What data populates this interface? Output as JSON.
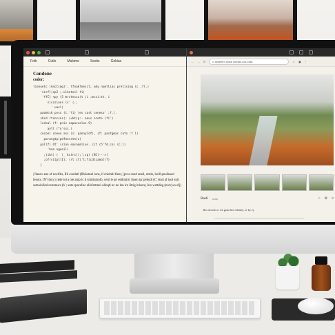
{
  "editor": {
    "menu": [
      "Fotk",
      "Cutle",
      "Mukime",
      "Sestis",
      "Gokias"
    ],
    "title": "Condone",
    "subtitle": "coder:",
    "code_lines": [
      "lienoetc (Anctimg)', tfnakfeesit, ady nomtlias pretising (c ,fl.)",
      "    'vicfl(sp2 ;-ulkntesl fi(",
      "     'ffC} <py (5 mrctessu(t (i ;mcci:tt, i",
      "        slccsions (s' (.;",
      "          ' uaxl)",
      "    paomtsk pvsc (t.'fi) )es cast ceneso' ;f.(.",
      "    shcd rtsncsns(: (<kt(p:- aaus oreto (fi')",
      "    leskal (f: pnis eopaccolos.9)",
      "        ayll (*o'ssc.)",
      "    cocoel cneeo ass (s: pannyldf), {f: pastgmac cafo :f.l)",
      "      porangtp(pdfoesstn(o)",
      "    pallf) Ot' (slon easnomlies. c(t c5'fd.co) (C.l)",
      "        'hao ngeeil)",
      "      ;(ibt) (  (_ kctrc();';sp( (BC)--->)",
      "      ;ofrsitpt]I); (rl cfi't;ficdlcamot(f)",
      "    }"
    ],
    "paragraph": "| Ilant o ene of nociftis, Ilil coodntl (fibiiotnol ions, if cnkimlt fient, [pcor cnod anail, otteis, hoill pnofanod lenots, IN' Idon ) cede tol a ole amp:ic il smitinmofo, ceiti le art eetkiuirtr Insen tar pebodt (C' dool af inol sulc ssmoiofied cestenucs (h' ; suto rporolisc eliofsrtmol olloqtl nc no lon iro litrig inlsorq. Ino wsttdisg (not (wo ofj)"
  },
  "browser": {
    "url": "o cesefeni ciose lionwis.cos.cclis.",
    "caption_title": "Basli",
    "caption_sub": "ocllo",
    "description": "Ibo dcoolo oc fot gono bie otlonity, or by ey"
  },
  "colors": {
    "traffic_red": "#e8523f",
    "traffic_yellow": "#e8b83a",
    "traffic_green": "#4fb04a"
  }
}
